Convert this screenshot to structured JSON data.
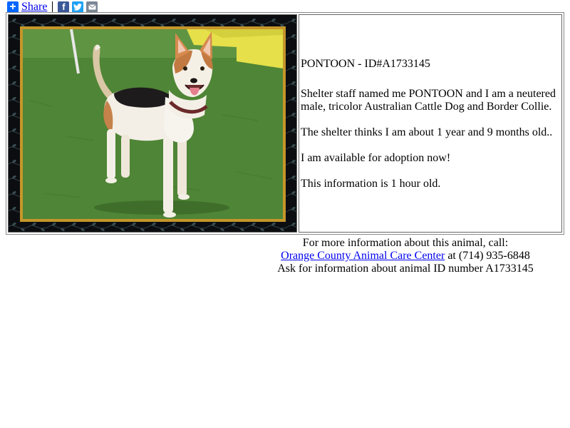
{
  "share": {
    "label": "Share",
    "icons": [
      "plus-icon",
      "facebook-icon",
      "twitter-icon",
      "email-icon"
    ]
  },
  "animal": {
    "heading": "PONTOON - ID#A1733145",
    "description": "Shelter staff named me PONTOON and I am a neutered male, tricolor Australian Cattle Dog and Border Collie.",
    "age": "The shelter thinks I am about 1 year and 9 months old..",
    "availability": "I am available for adoption now!",
    "freshness": "This information is 1 hour old."
  },
  "contact": {
    "intro": "For more information about this animal, call:",
    "shelter_name": "Orange County Animal Care Center",
    "phone_text": " at (714) 935-6848",
    "id_line": "Ask for information about animal ID number A1733145"
  },
  "colors": {
    "link": "#0000ee",
    "frame_gold": "#c5962a",
    "share_blue": "#0166ff",
    "facebook": "#3b5998",
    "twitter": "#1da1f2",
    "email": "#7b8795"
  }
}
